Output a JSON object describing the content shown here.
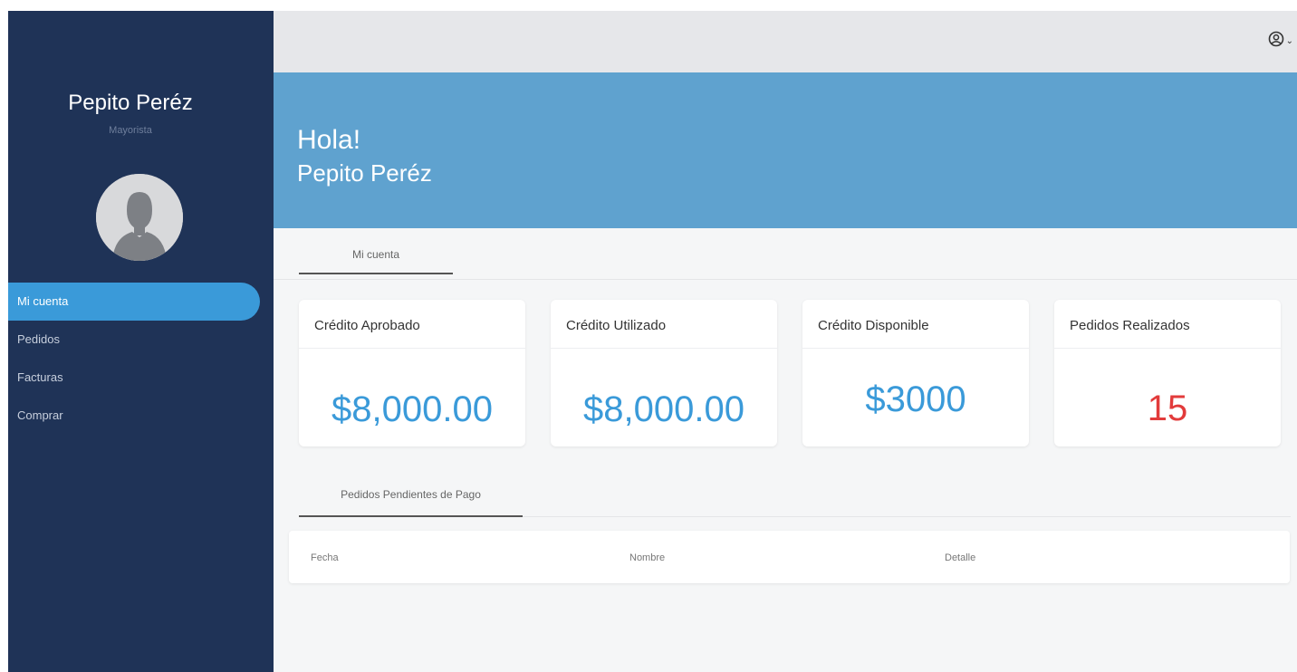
{
  "sidebar": {
    "user_name": "Pepito Peréz",
    "user_role": "Mayorista",
    "avatar_icon": "user-avatar-icon",
    "items": [
      {
        "label": "Mi cuenta",
        "active": true
      },
      {
        "label": "Pedidos",
        "active": false
      },
      {
        "label": "Facturas",
        "active": false
      },
      {
        "label": "Comprar",
        "active": false
      }
    ]
  },
  "topbar": {
    "user_menu_icon": "user-circle-icon",
    "chevron_icon": "chevron-down-icon",
    "chevron_glyph": "⌄"
  },
  "hero": {
    "greeting": "Hola!",
    "name": "Pepito Peréz"
  },
  "tabs": {
    "account": "Mi cuenta",
    "pending": "Pedidos Pendientes de Pago"
  },
  "cards": [
    {
      "title": "Crédito Aprobado",
      "value": "$8,000.00"
    },
    {
      "title": "Crédito Utilizado",
      "value": "$8,000.00"
    },
    {
      "title": "Crédito Disponible",
      "value": "$3000"
    },
    {
      "title": "Pedidos Realizados",
      "value": "15"
    }
  ],
  "table": {
    "columns": [
      "Fecha",
      "Nombre",
      "Detalle"
    ]
  },
  "colors": {
    "sidebar_bg": "#1f3357",
    "accent": "#3a9ad9",
    "hero_bg": "#5fa2cf",
    "danger": "#e23b3b"
  }
}
